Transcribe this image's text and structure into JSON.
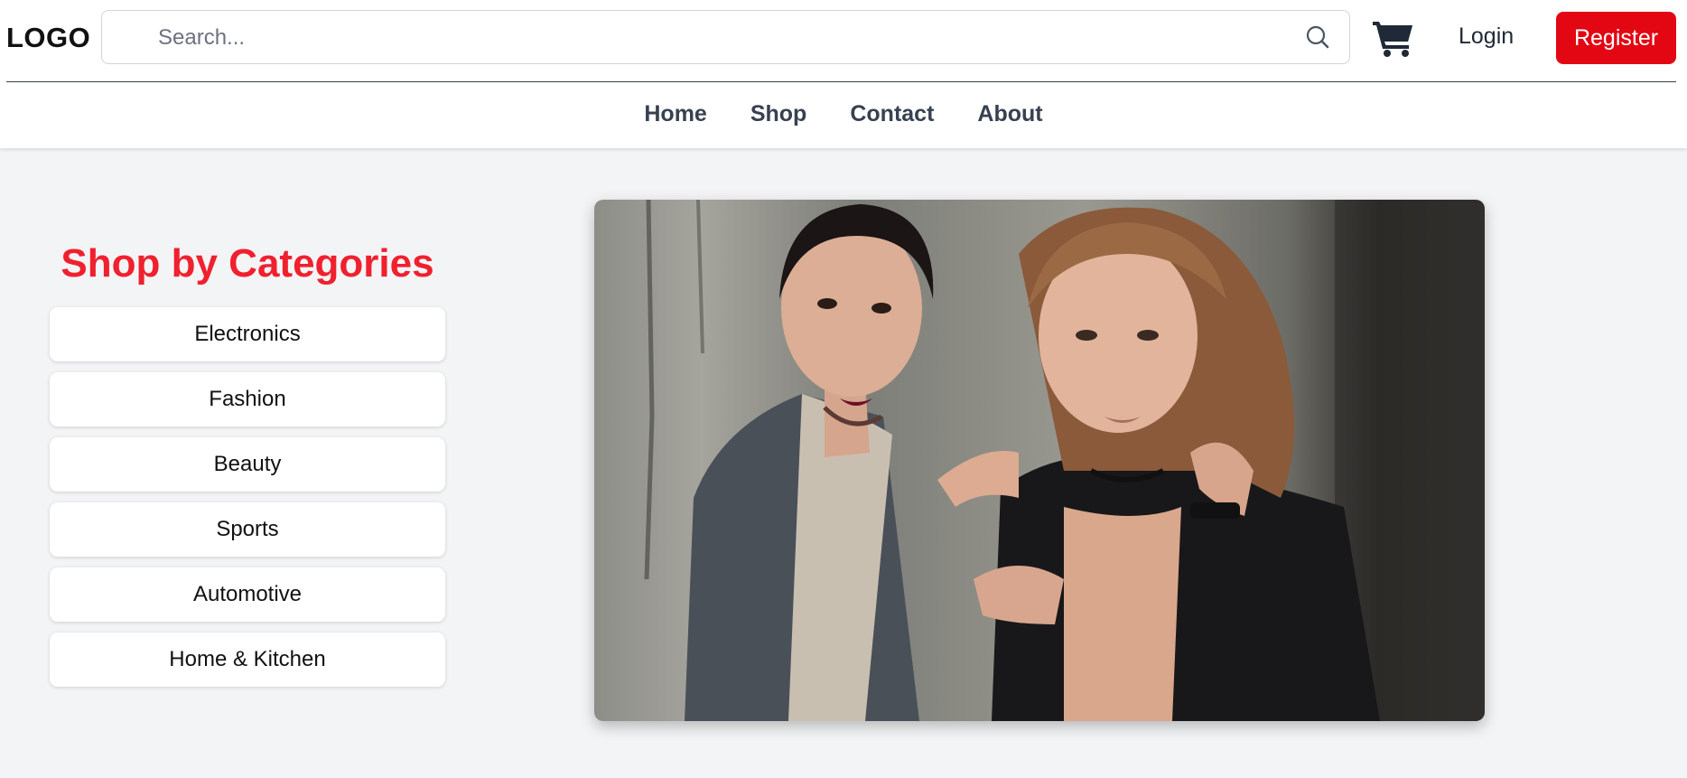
{
  "header": {
    "logo": "LOGO",
    "search": {
      "placeholder": "Search...",
      "value": ""
    },
    "login_label": "Login",
    "register_label": "Register"
  },
  "nav": {
    "items": [
      {
        "label": "Home"
      },
      {
        "label": "Shop"
      },
      {
        "label": "Contact"
      },
      {
        "label": "About"
      }
    ]
  },
  "categories": {
    "title": "Shop by Categories",
    "items": [
      {
        "label": "Electronics"
      },
      {
        "label": "Fashion"
      },
      {
        "label": "Beauty"
      },
      {
        "label": "Sports"
      },
      {
        "label": "Automotive"
      },
      {
        "label": "Home & Kitchen"
      }
    ]
  },
  "icons": [
    "search-icon",
    "cart-icon"
  ],
  "colors": {
    "brand_red": "#e30613",
    "title_red": "#f0202e",
    "background": "#f3f4f6",
    "nav_text": "#374151"
  }
}
